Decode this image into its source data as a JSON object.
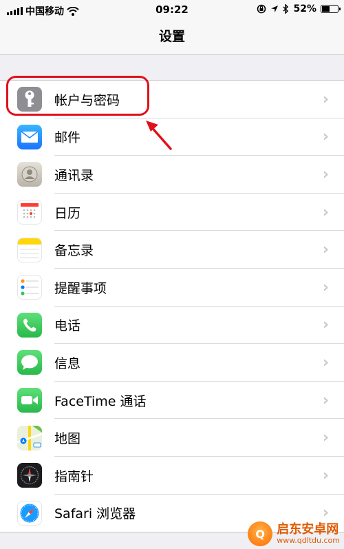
{
  "status_bar": {
    "carrier": "中国移动",
    "time": "09:22",
    "battery_percent": "52%",
    "battery_level": 0.52,
    "icons": [
      "signal-icon",
      "wifi-icon",
      "rotation-lock-icon",
      "location-icon",
      "bluetooth-icon",
      "battery-icon"
    ]
  },
  "nav": {
    "title": "设置"
  },
  "settings_items": [
    {
      "label": "帐户与密码",
      "icon": "key-icon",
      "color": "#8e8e93"
    },
    {
      "label": "邮件",
      "icon": "mail-icon",
      "color": "#1a8cff"
    },
    {
      "label": "通讯录",
      "icon": "contacts-icon",
      "color": "#c9c3b8"
    },
    {
      "label": "日历",
      "icon": "calendar-icon",
      "color": "#ffffff"
    },
    {
      "label": "备忘录",
      "icon": "notes-icon",
      "color": "#ffffff"
    },
    {
      "label": "提醒事项",
      "icon": "reminders-icon",
      "color": "#ffffff"
    },
    {
      "label": "电话",
      "icon": "phone-icon",
      "color": "#34c759"
    },
    {
      "label": "信息",
      "icon": "messages-icon",
      "color": "#34c759"
    },
    {
      "label": "FaceTime 通话",
      "icon": "facetime-icon",
      "color": "#34c759"
    },
    {
      "label": "地图",
      "icon": "maps-icon",
      "color": "#6cc04a"
    },
    {
      "label": "指南针",
      "icon": "compass-icon",
      "color": "#1c1c1e"
    },
    {
      "label": "Safari 浏览器",
      "icon": "safari-icon",
      "color": "#ffffff"
    }
  ],
  "watermark": {
    "title": "启东安卓网",
    "url": "www.qdltdu.com"
  },
  "colors": {
    "highlight": "#e0111b",
    "chevron": "#c7c7cc",
    "background": "#efeff4"
  }
}
